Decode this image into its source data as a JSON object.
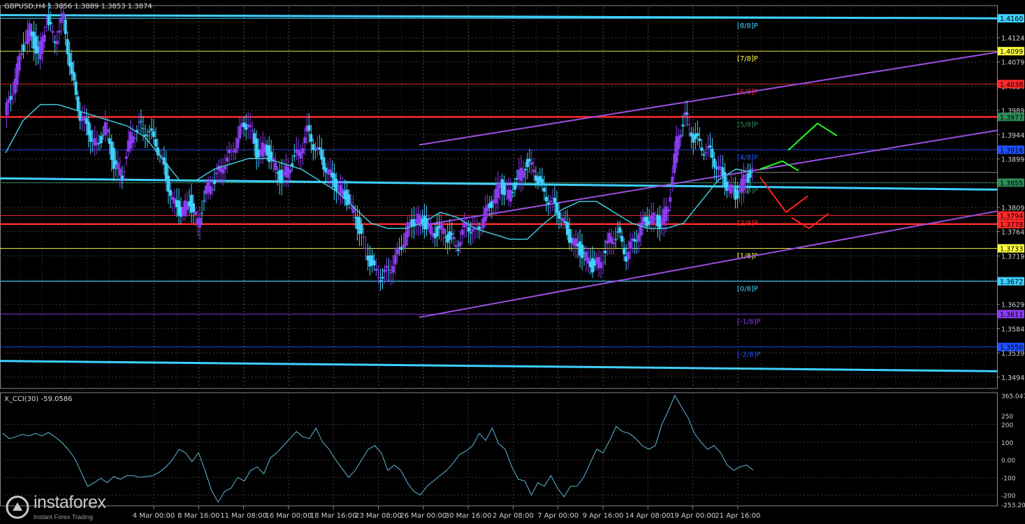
{
  "header": {
    "title": "GBPUSD,H4  1.3856 1.3889 1.3853 1.3874"
  },
  "cci_header": {
    "label": "X_CCI(30) -59.0586"
  },
  "logo": {
    "brand": "instaforex",
    "tagline": "Instant Forex Trading"
  },
  "colors": {
    "background": "#000000",
    "grid": "#3a3a3a",
    "bull": "#8a3cf0",
    "bear": "#3fd0ff",
    "ma": "#40c8d8",
    "channel": "#9a4fe0",
    "murrey_red": "#ff2a2a",
    "cci_line": "#5fb8d8",
    "up_arrow": "#22ff22",
    "down_arrow": "#ff2020",
    "axis_text": "#d0d0d0"
  },
  "chart_data": {
    "type": "candlestick",
    "symbol": "GBPUSD",
    "timeframe": "H4",
    "ohlc_header": {
      "open": 1.3856,
      "high": 1.3889,
      "low": 1.3853,
      "close": 1.3874
    },
    "ylim": [
      1.3473,
      1.4181
    ],
    "y_ticks": [
      "1.4160",
      "1.4124",
      "1.4079",
      "1.4034",
      "1.3989",
      "1.3944",
      "1.3899",
      "1.3854",
      "1.3809",
      "1.3764",
      "1.3719",
      "1.3674",
      "1.3629",
      "1.3584",
      "1.3539",
      "1.3494"
    ],
    "x_ticks": [
      "4 Mar 00:00",
      "8 Mar 16:00",
      "11 Mar 08:00",
      "16 Mar 00:00",
      "18 Mar 16:00",
      "23 Mar 08:00",
      "26 Mar 00:00",
      "30 Mar 16:00",
      "2 Apr 08:00",
      "7 Apr 00:00",
      "9 Apr 16:00",
      "14 Apr 08:00",
      "19 Apr 00:00",
      "21 Apr 16:00"
    ],
    "current_price": "1.3874",
    "price_path": [
      1.398,
      1.403,
      1.41,
      1.414,
      1.409,
      1.4155,
      1.412,
      1.416,
      1.405,
      1.398,
      1.395,
      1.392,
      1.396,
      1.389,
      1.387,
      1.394,
      1.396,
      1.395,
      1.393,
      1.388,
      1.382,
      1.38,
      1.382,
      1.378,
      1.384,
      1.386,
      1.389,
      1.391,
      1.395,
      1.397,
      1.391,
      1.392,
      1.389,
      1.386,
      1.389,
      1.391,
      1.395,
      1.392,
      1.389,
      1.386,
      1.384,
      1.382,
      1.378,
      1.373,
      1.369,
      1.368,
      1.37,
      1.373,
      1.377,
      1.379,
      1.378,
      1.376,
      1.377,
      1.375,
      1.374,
      1.378,
      1.376,
      1.379,
      1.382,
      1.385,
      1.383,
      1.386,
      1.389,
      1.388,
      1.384,
      1.382,
      1.38,
      1.376,
      1.374,
      1.372,
      1.37,
      1.371,
      1.375,
      1.376,
      1.372,
      1.375,
      1.378,
      1.379,
      1.378,
      1.381,
      1.393,
      1.398,
      1.394,
      1.392,
      1.391,
      1.388,
      1.385,
      1.383,
      1.386,
      1.3874
    ],
    "moving_average": [
      1.391,
      1.397,
      1.4,
      1.4,
      1.399,
      1.398,
      1.397,
      1.396,
      1.394,
      1.39,
      1.386,
      1.386,
      1.388,
      1.389,
      1.39,
      1.39,
      1.389,
      1.388,
      1.386,
      1.384,
      1.381,
      1.378,
      1.377,
      1.377,
      1.378,
      1.38,
      1.379,
      1.377,
      1.376,
      1.375,
      1.375,
      1.378,
      1.3805,
      1.382,
      1.382,
      1.38,
      1.378,
      1.377,
      1.377,
      1.378,
      1.382,
      1.386,
      1.388,
      1.3874
    ],
    "murrey_levels": [
      {
        "label": "[8/8]P",
        "value": "1.4160",
        "color": "#3fd0ff"
      },
      {
        "label": "[7/8]P",
        "value": "1.4099",
        "color": "#ffff40"
      },
      {
        "label": "[6/8]P",
        "value": "1.4038",
        "color": "#ff2a2a"
      },
      {
        "label": "[5/8]P",
        "value": "1.3977",
        "color": "#2e8b57"
      },
      {
        "label": "[4/8]P",
        "value": "1.3916",
        "color": "#1e50ff"
      },
      {
        "label": "[3/8]P",
        "value": "1.3855",
        "color": "#2e8b57"
      },
      {
        "label": "[2/8]P",
        "value": "1.3794",
        "color": "#ff2a2a"
      },
      {
        "label": "[1/8]P",
        "value": "1.3733",
        "color": "#ffff40"
      },
      {
        "label": "[0/8]P",
        "value": "1.3672",
        "color": "#3fd0ff"
      },
      {
        "label": "[-1/8]P",
        "value": "1.3611",
        "color": "#8a3cf0"
      },
      {
        "label": "[-2/8]P",
        "value": "1.3550",
        "color": "#1e50ff"
      }
    ],
    "extra_level": {
      "value": "1.3778",
      "color": "#ff2a2a"
    },
    "cci": {
      "name": "X_CCI(30)",
      "last": -59.0586,
      "ylim": [
        -253.203,
        365.0474
      ],
      "y_ticks": [
        "365.0474",
        "250",
        "200",
        "100",
        "0.00",
        "-100",
        "-200",
        "-253.203"
      ],
      "values": [
        150,
        120,
        130,
        145,
        135,
        150,
        135,
        155,
        130,
        100,
        60,
        10,
        -70,
        -150,
        -130,
        -105,
        -130,
        -95,
        -110,
        -90,
        -90,
        -100,
        -95,
        -90,
        -70,
        -40,
        0,
        60,
        40,
        -10,
        40,
        -60,
        -175,
        -240,
        -180,
        -160,
        -100,
        -120,
        -60,
        -40,
        -80,
        10,
        40,
        80,
        120,
        160,
        130,
        120,
        180,
        100,
        60,
        0,
        -50,
        -100,
        -60,
        0,
        60,
        80,
        40,
        -60,
        -30,
        -60,
        -130,
        -180,
        -200,
        -150,
        -120,
        -90,
        -60,
        -20,
        30,
        50,
        80,
        150,
        110,
        180,
        90,
        60,
        -40,
        -110,
        -120,
        -200,
        -130,
        -150,
        -90,
        -160,
        -210,
        -150,
        -150,
        -100,
        -20,
        60,
        40,
        110,
        190,
        160,
        150,
        120,
        80,
        60,
        80,
        200,
        280,
        365,
        300,
        240,
        150,
        100,
        60,
        80,
        40,
        -30,
        -60,
        -40,
        -30,
        -59
      ]
    }
  }
}
